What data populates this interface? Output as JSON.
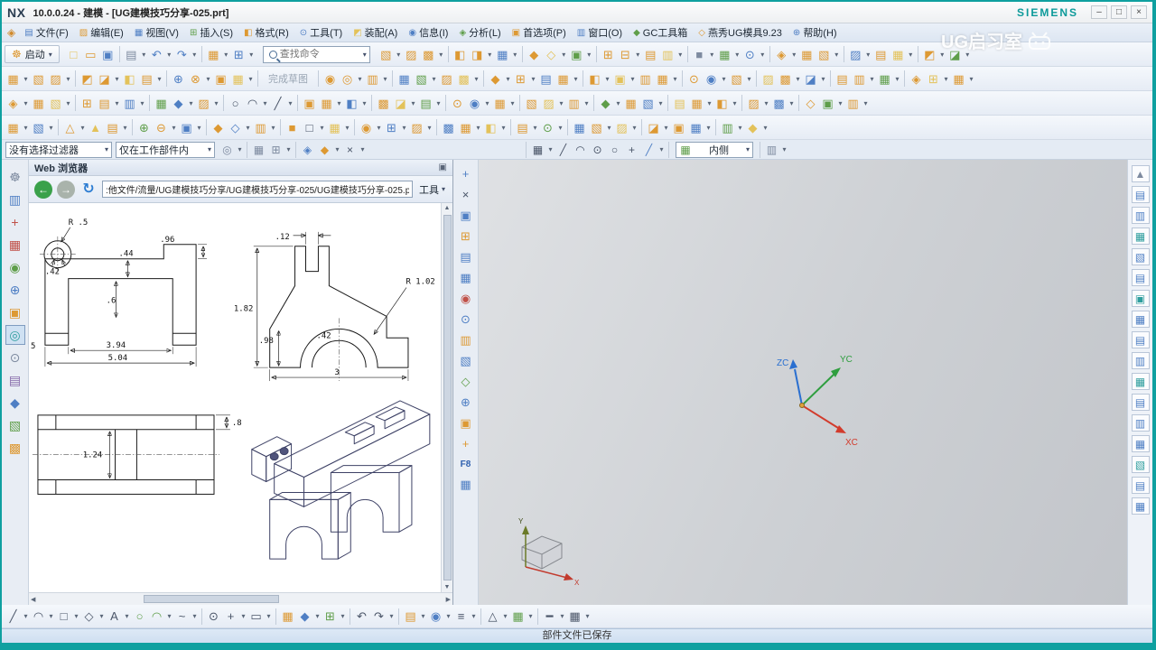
{
  "window": {
    "logo": "NX",
    "title": "10.0.0.24 - 建模 - [UG建模技巧分享-025.prt]",
    "brand": "SIEMENS",
    "app_icon": "◈",
    "controls": {
      "min": "–",
      "max": "□",
      "close": "×"
    }
  },
  "watermark": {
    "text": "UG启习室"
  },
  "menu": {
    "items": [
      "▤|b|文件(F)",
      "▨|o|编辑(E)",
      "▦|b|视图(V)",
      "⊞|g|插入(S)",
      "◧|o|格式(R)",
      "⊙|b|工具(T)",
      "◩|y|装配(A)",
      "◉|b|信息(I)",
      "◈|g|分析(L)",
      "▣|o|首选项(P)",
      "▥|b|窗口(O)",
      "◆|g|GC工具箱",
      "◇|o|燕秀UG模具9.23",
      "⊕|b|帮助(H)"
    ]
  },
  "toolbar1": {
    "start_label": "启动",
    "find_placeholder": "查找命令"
  },
  "selection_bar": {
    "filter_value": "没有选择过滤器",
    "scope_value": "仅在工作部件内",
    "side_value": "内侧"
  },
  "browser": {
    "title": "Web 浏览器",
    "float_icon": "▣",
    "address": ":他文件/流量/UG建模技巧分享/UG建模技巧分享-025/UG建模技巧分享-025.png",
    "tools_label": "工具",
    "back_glyph": "←",
    "forward_glyph": "→",
    "refresh_glyph": "↻"
  },
  "drawing": {
    "v1": {
      "r5": "R .5",
      "d42": ".42",
      "d44": ".44",
      "d96": ".96",
      "d6": ".6",
      "d5": "5",
      "d394": "3.94",
      "d504": "5.04"
    },
    "v2": {
      "d12": ".12",
      "r102": "R 1.02",
      "d182": "1.82",
      "d98": ".98",
      "d42": ".42",
      "d3": "3"
    },
    "v3": {
      "d8": ".8",
      "d124": "1.24"
    }
  },
  "graphics": {
    "zc": "ZC",
    "yc": "YC",
    "xc": "XC",
    "mini_x": "X",
    "mini_y": "Y"
  },
  "statusbar": {
    "message": "部件文件已保存"
  },
  "icons": {
    "row1_left": [
      "□|y",
      "▭|o",
      "▣|b",
      "sep",
      "▤|k",
      "car",
      "↶|b",
      "car",
      "↷|b",
      "car",
      "sep",
      "▦|o",
      "car",
      "⊞|b",
      "car"
    ],
    "row1_right": [
      "▧|o",
      "car",
      "▨|o",
      "▩|o",
      "car",
      "sep",
      "◧|o",
      "◨|o",
      "car",
      "▦|b",
      "car",
      "sep",
      "◆|o",
      "◇|y",
      "car",
      "▣|g",
      "car",
      "sep",
      "⊞|o",
      "⊟|o",
      "car",
      "▤|o",
      "▥|y",
      "car",
      "sep",
      "■|k",
      "car",
      "▦|g",
      "car",
      "⊙|b",
      "car",
      "sep",
      "◈|o",
      "car",
      "▦|o",
      "▧|o",
      "car",
      "sep",
      "▨|b",
      "car",
      "▤|o",
      "▦|y",
      "car",
      "sep",
      "◩|o",
      "car",
      "◪|g",
      "car"
    ],
    "row2": [
      "▦|o",
      "car",
      "▧|o",
      "▨|o",
      "car",
      "sep",
      "◩|o",
      "◪|o",
      "car",
      "◧|y",
      "▤|o",
      "car",
      "sep",
      "⊕|b",
      "⊗|o",
      "car",
      "▣|o",
      "▦|y",
      "car",
      "sep",
      "txt|完成草图",
      "sep",
      "◉|o",
      "◎|o",
      "car",
      "▥|o",
      "car",
      "sep",
      "▦|b",
      "▧|g",
      "car",
      "▨|o",
      "▩|y",
      "car",
      "sep",
      "◆|o",
      "car",
      "⊞|o",
      "car",
      "▤|b",
      "▦|o",
      "car",
      "sep",
      "◧|o",
      "car",
      "▣|y",
      "car",
      "▥|o",
      "▦|o",
      "car",
      "sep",
      "⊙|o",
      "◉|b",
      "car",
      "▧|o",
      "car",
      "sep",
      "▨|y",
      "▩|o",
      "car",
      "◪|b",
      "car",
      "sep",
      "▤|o",
      "▥|o",
      "car",
      "▦|g",
      "car",
      "sep",
      "◈|o",
      "⊞|y",
      "car",
      "▦|o",
      "car"
    ],
    "row3": [
      "◈|o",
      "car",
      "▦|o",
      "▧|y",
      "car",
      "sep",
      "⊞|o",
      "▤|o",
      "car",
      "▥|b",
      "car",
      "sep",
      "▦|g",
      "◆|b",
      "car",
      "▨|o",
      "car",
      "sep",
      "○|d",
      "◠|d",
      "car",
      "╱|d",
      "car",
      "sep",
      "▣|o",
      "▦|o",
      "car",
      "◧|b",
      "car",
      "sep",
      "▩|o",
      "◪|y",
      "car",
      "▤|g",
      "car",
      "sep",
      "⊙|o",
      "◉|b",
      "car",
      "▦|o",
      "car",
      "sep",
      "▧|o",
      "▨|y",
      "car",
      "▥|o",
      "car",
      "sep",
      "◆|g",
      "car",
      "▦|o",
      "▧|b",
      "car",
      "sep",
      "▤|y",
      "▦|o",
      "car",
      "◧|o",
      "car",
      "sep",
      "▨|o",
      "car",
      "▩|b",
      "car",
      "sep",
      "◇|o",
      "▣|g",
      "car",
      "▥|o",
      "car"
    ],
    "row4": [
      "▦|o",
      "car",
      "▧|b",
      "car",
      "sep",
      "△|o",
      "car",
      "▲|y",
      "▤|o",
      "car",
      "sep",
      "⊕|g",
      "⊖|o",
      "car",
      "▣|b",
      "car",
      "sep",
      "◆|o",
      "◇|b",
      "car",
      "▥|o",
      "car",
      "sep",
      "■|o",
      "□|d",
      "car",
      "▦|y",
      "car",
      "sep",
      "◉|o",
      "car",
      "⊞|b",
      "car",
      "▨|o",
      "car",
      "sep",
      "▩|b",
      "▦|o",
      "car",
      "◧|y",
      "car",
      "sep",
      "▤|o",
      "car",
      "⊙|g",
      "car",
      "sep",
      "▦|b",
      "▧|o",
      "car",
      "▨|y",
      "car",
      "sep",
      "◪|o",
      "car",
      "▣|o",
      "▦|b",
      "car",
      "sep",
      "▥|g",
      "car",
      "◆|y",
      "car"
    ],
    "selbar_a": [
      "◎|k",
      "car",
      "sep",
      "▦|k",
      "⊞|k",
      "car",
      "sep",
      "◈|b",
      "◆|o",
      "car",
      "×|d",
      "car"
    ],
    "selbar_b": [
      "sep",
      "▦|d",
      "car",
      "╱|d",
      "◠|d",
      "⊙|d",
      "○|d",
      "+|d",
      "╱|b",
      "car",
      "sep"
    ],
    "selbar_c": [
      "sep",
      "▥|k",
      "car"
    ],
    "bottom": [
      "╱|d",
      "car",
      "◠|d",
      "car",
      "□|d",
      "car",
      "◇|d",
      "car",
      "A|d",
      "car",
      "○|g",
      "◠|g",
      "car",
      "~|d",
      "car",
      "sep",
      "⊙|d",
      "+|d",
      "car",
      "▭|d",
      "car",
      "sep",
      "▦|o",
      "◆|b",
      "car",
      "⊞|g",
      "car",
      "sep",
      "↶|d",
      "↷|d",
      "car",
      "sep",
      "▤|o",
      "car",
      "◉|b",
      "car",
      "≡|d",
      "car",
      "sep",
      "△|d",
      "car",
      "▦|g",
      "car",
      "sep",
      "━|d",
      "car",
      "▦|d",
      "car"
    ],
    "left_strip": [
      "☸|k",
      "▥|b",
      "+|r",
      "▦|r",
      "◉|g",
      "⊕|b",
      "▣|o",
      "sel:◎|t",
      "⊙|k",
      "▤|p",
      "◆|b",
      "▧|g",
      "▩|o"
    ],
    "mid_strip": [
      "+|b",
      "×|d",
      "▣|b",
      "⊞|o",
      "▤|b",
      "▦|b",
      "◉|r",
      "⊙|b",
      "▥|o",
      "▧|b",
      "◇|g",
      "⊕|b",
      "▣|o",
      "+|o",
      "txt|F8",
      "▦|b"
    ],
    "right_strip": [
      "▲|k",
      "▤|b",
      "▥|b",
      "▦|t",
      "▧|b",
      "▤|b",
      "▣|t",
      "▦|b",
      "▤|b",
      "▥|b",
      "▦|t",
      "▤|b",
      "▥|b",
      "▦|b",
      "▧|t",
      "▤|b",
      "▦|b"
    ]
  }
}
